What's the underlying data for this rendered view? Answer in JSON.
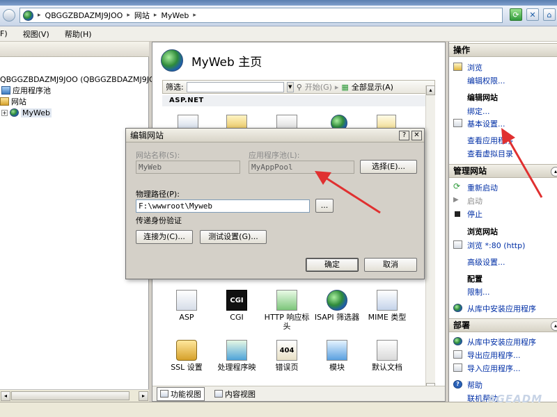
{
  "address": {
    "segments": [
      "QBGGZBDAZMJ9JOO",
      "网站",
      "MyWeb"
    ],
    "separator": "▸"
  },
  "menu": {
    "items": [
      "F)",
      "视图(V)",
      "帮助(H)"
    ]
  },
  "tree": {
    "server": "QBGGZBDAZMJ9JOO (QBGGZBDAZMJ9JOO\\Admi",
    "app_pools": "应用程序池",
    "sites": "网站",
    "site": "MyWeb"
  },
  "center": {
    "title": "MyWeb 主页",
    "filter_label": "筛选:",
    "start_label": "开始(G)",
    "show_all_label": "全部显示(A)",
    "section_label": "ASP.NET",
    "features": [
      {
        "label": "ASP",
        "icon": "asp-icon"
      },
      {
        "label": "CGI",
        "icon": "cgi-icon"
      },
      {
        "label": "HTTP 响应标头",
        "icon": "http-response-headers-icon"
      },
      {
        "label": "ISAPI 筛选器",
        "icon": "isapi-filters-icon"
      },
      {
        "label": "MIME 类型",
        "icon": "mime-types-icon"
      },
      {
        "label": "SSL 设置",
        "icon": "ssl-settings-icon"
      },
      {
        "label": "处理程序映",
        "icon": "handler-mappings-icon"
      },
      {
        "label": "错误页",
        "icon": "error-pages-icon"
      },
      {
        "label": "模块",
        "icon": "modules-icon"
      },
      {
        "label": "默认文档",
        "icon": "default-document-icon"
      }
    ],
    "cgi_badge": "CGI",
    "error_badge": "404",
    "view_tabs": [
      "功能视图",
      "内容视图"
    ]
  },
  "actions": {
    "header": "操作",
    "browse": "浏览",
    "edit_permissions": "编辑权限...",
    "edit_site_header": "编辑网站",
    "bindings": "绑定...",
    "basic_settings": "基本设置...",
    "view_apps": "查看应用程序",
    "view_vdirs": "查看虚拟目录",
    "manage_site_header": "管理网站",
    "restart": "重新启动",
    "start": "启动",
    "stop": "停止",
    "browse_site_header": "浏览网站",
    "browse_80": "浏览 *:80 (http)",
    "advanced_settings": "高级设置...",
    "config_header": "配置",
    "limits": "限制...",
    "install_from_gallery": "从库中安装应用程序",
    "deploy_header": "部署",
    "deploy_install": "从库中安装应用程序",
    "export_app": "导出应用程序...",
    "import_app": "导入应用程序...",
    "help": "帮助",
    "online_help": "联机帮助"
  },
  "watermark": "AGEADM",
  "dialog": {
    "title": "编辑网站",
    "help_btn": "?",
    "close_btn": "✕",
    "site_name_label": "网站名称(S):",
    "site_name_value": "MyWeb",
    "app_pool_label": "应用程序池(L):",
    "app_pool_value": "MyAppPool",
    "select_btn": "选择(E)...",
    "physical_path_label": "物理路径(P):",
    "physical_path_value": "F:\\wwwroot\\Myweb",
    "browse_btn": "...",
    "passthrough_label": "传递身份验证",
    "connect_as_btn": "连接为(C)...",
    "test_settings_btn": "测试设置(G)...",
    "ok_btn": "确定",
    "cancel_btn": "取消"
  },
  "colors": {
    "link": "#002fa6",
    "arrow": "#e03030",
    "dialog_bg": "#d4d0c8"
  }
}
